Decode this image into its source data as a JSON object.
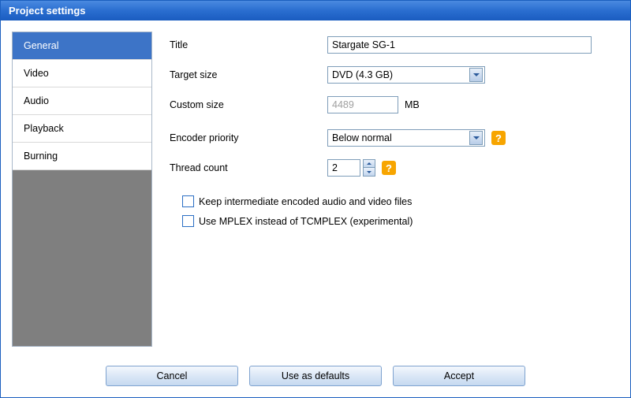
{
  "window": {
    "title": "Project settings"
  },
  "sidebar": {
    "items": [
      {
        "label": "General",
        "active": true
      },
      {
        "label": "Video",
        "active": false
      },
      {
        "label": "Audio",
        "active": false
      },
      {
        "label": "Playback",
        "active": false
      },
      {
        "label": "Burning",
        "active": false
      }
    ]
  },
  "form": {
    "title": {
      "label": "Title",
      "value": "Stargate SG-1"
    },
    "target_size": {
      "label": "Target size",
      "value": "DVD (4.3 GB)"
    },
    "custom_size": {
      "label": "Custom size",
      "value": "4489",
      "unit": "MB",
      "disabled": true
    },
    "encoder_priority": {
      "label": "Encoder priority",
      "value": "Below normal"
    },
    "thread_count": {
      "label": "Thread count",
      "value": "2"
    },
    "keep_intermediate": {
      "label": "Keep intermediate encoded audio and video files",
      "checked": false
    },
    "use_mplex": {
      "label": "Use MPLEX instead of TCMPLEX (experimental)",
      "checked": false
    }
  },
  "footer": {
    "cancel": "Cancel",
    "use_defaults": "Use as defaults",
    "accept": "Accept"
  },
  "icons": {
    "help": "?"
  }
}
